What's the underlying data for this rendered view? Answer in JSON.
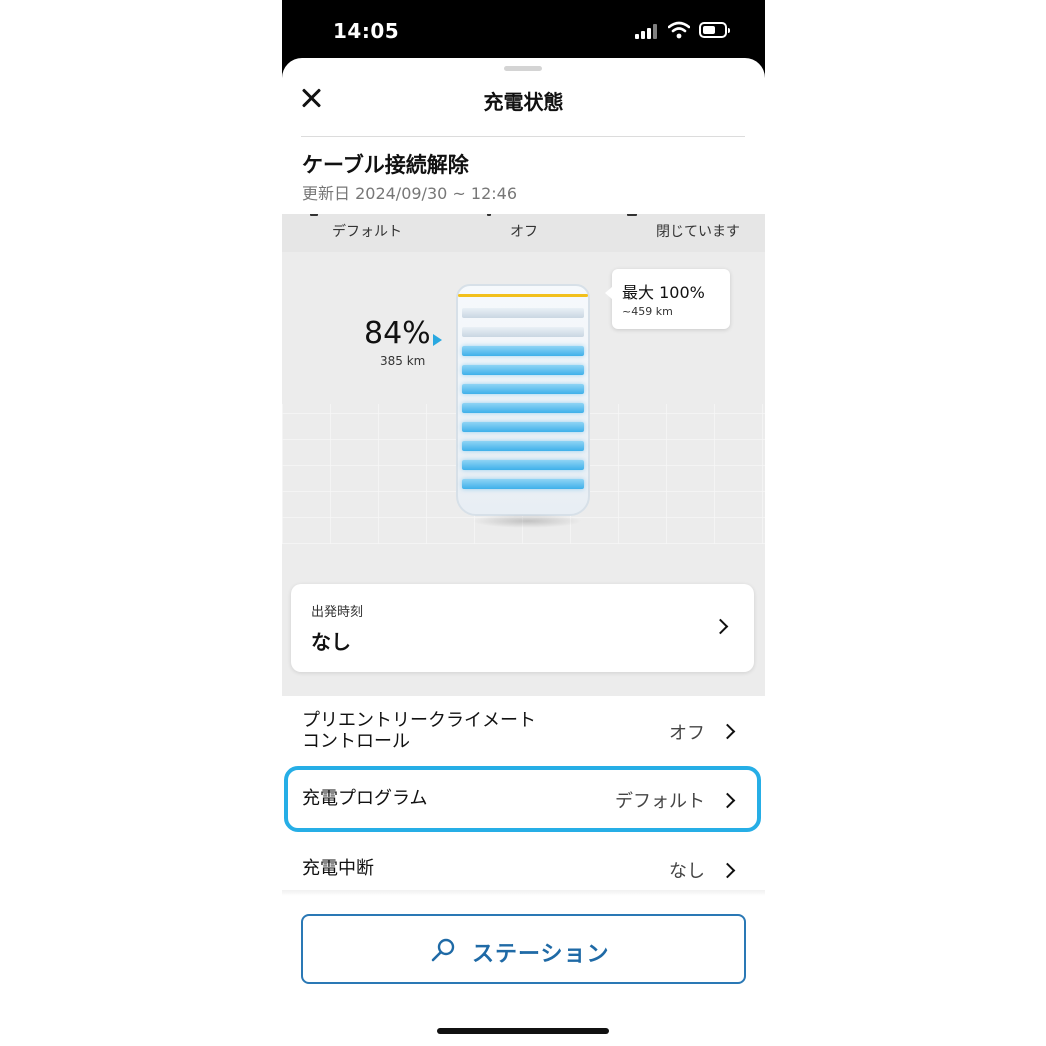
{
  "status_bar": {
    "time": "14:05"
  },
  "nav": {
    "title": "充電状態"
  },
  "status": {
    "title": "ケーブル接続解除",
    "updated": "更新日 2024/09/30 ~ 12:46"
  },
  "quick_strip": {
    "item1": "デフォルト",
    "item2": "オフ",
    "item3": "閉じています"
  },
  "battery": {
    "percent": "84%",
    "range": "385 km",
    "max_label": "最大 100%",
    "max_range": "~459 km",
    "charge_level": 0.84,
    "bar_color": "#3fb0ea",
    "limit_color": "#f2c01c"
  },
  "departure": {
    "label": "出発時刻",
    "value": "なし"
  },
  "rows": [
    {
      "label": "プリエントリークライメート\nコントロール",
      "value": "オフ"
    },
    {
      "label": "充電プログラム",
      "value": "デフォルト"
    },
    {
      "label": "充電中断",
      "value": "なし"
    }
  ],
  "station_button": {
    "label": "ステーション",
    "icon": "search-icon",
    "color": "#1f6aa6"
  },
  "highlight_color": "#26aee6"
}
